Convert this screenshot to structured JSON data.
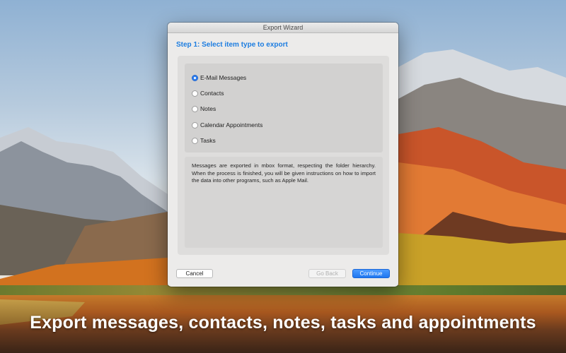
{
  "window": {
    "title": "Export Wizard",
    "step_title": "Step 1: Select item type to export",
    "options": [
      {
        "label": "E-Mail Messages",
        "checked": true
      },
      {
        "label": "Contacts",
        "checked": false
      },
      {
        "label": "Notes",
        "checked": false
      },
      {
        "label": "Calendar Appointments",
        "checked": false
      },
      {
        "label": "Tasks",
        "checked": false
      }
    ],
    "description": "Messages are exported in mbox format, respecting the folder hierarchy. When the process is finished, you will be given instructions on how to import the data into other programs, such as Apple Mail.",
    "buttons": {
      "cancel": "Cancel",
      "back": "Go Back",
      "continue": "Continue"
    },
    "accent_color": "#1d7de0"
  },
  "tagline": "Export messages, contacts, notes, tasks and appointments"
}
